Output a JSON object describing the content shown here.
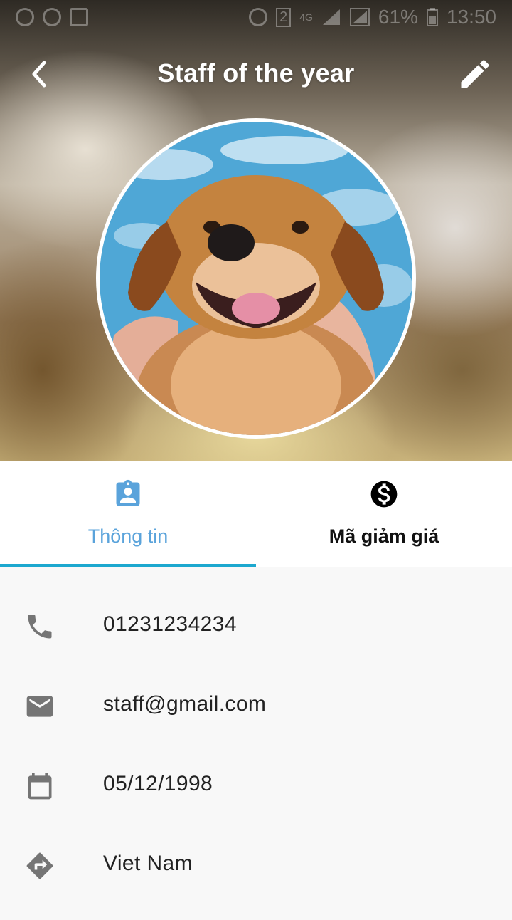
{
  "status_bar": {
    "battery_percent": "61%",
    "time": "13:50",
    "network": "4G",
    "sim": "2"
  },
  "toolbar": {
    "title": "Staff of the year"
  },
  "profile": {
    "avatar_description_icon": "puppy-photo"
  },
  "tabs": [
    {
      "label": "Thông tin",
      "icon": "assignment-ind-icon",
      "active": true
    },
    {
      "label": "Mã giảm giá",
      "icon": "monetization-on-icon",
      "active": false
    }
  ],
  "info": {
    "phone": "01231234234",
    "email": "staff@gmail.com",
    "birthday": "05/12/1998",
    "country": "Viet Nam"
  },
  "colors": {
    "accent": "#5aa3db",
    "indicator": "#1da8cf",
    "icon_gray": "#757575"
  }
}
